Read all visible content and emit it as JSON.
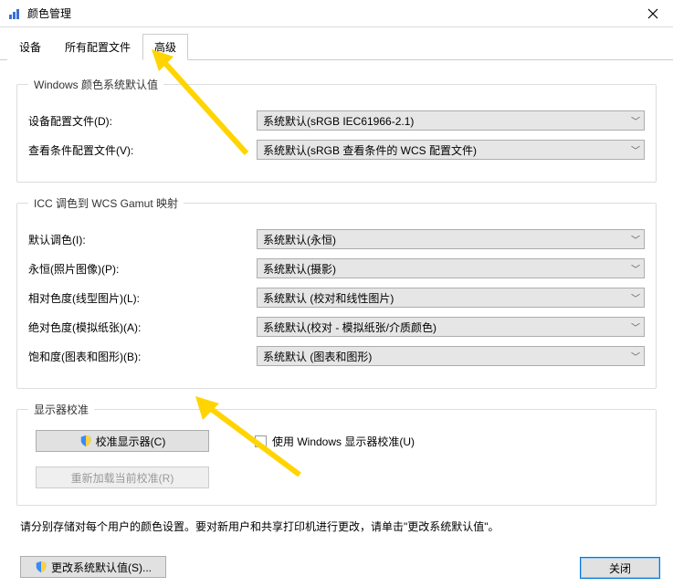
{
  "window": {
    "title": "颜色管理"
  },
  "tabs": {
    "device": "设备",
    "all_profiles": "所有配置文件",
    "advanced": "高级"
  },
  "group_defaults": {
    "legend": "Windows 颜色系统默认值",
    "device_profile_label": "设备配置文件(D):",
    "device_profile_value": "系统默认(sRGB IEC61966-2.1)",
    "viewing_label": "查看条件配置文件(V):",
    "viewing_value": "系统默认(sRGB 查看条件的 WCS 配置文件)"
  },
  "group_gamut": {
    "legend": "ICC 调色到 WCS Gamut 映射",
    "rendering_label": "默认调色(I):",
    "rendering_value": "系统默认(永恒)",
    "perceptual_label": "永恒(照片图像)(P):",
    "perceptual_value": "系统默认(摄影)",
    "relcol_label": "相对色度(线型图片)(L):",
    "relcol_value": "系统默认 (校对和线性图片)",
    "abscol_label": "绝对色度(模拟纸张)(A):",
    "abscol_value": "系统默认(校对 - 模拟纸张/介质颜色)",
    "sat_label": "饱和度(图表和图形)(B):",
    "sat_value": "系统默认 (图表和图形)"
  },
  "group_calib": {
    "legend": "显示器校准",
    "calibrate_btn": "校准显示器(C)",
    "use_win_calib": "使用 Windows 显示器校准(U)",
    "reload_btn": "重新加载当前校准(R)"
  },
  "hint_text": "请分别存储对每个用户的颜色设置。要对新用户和共享打印机进行更改，请单击\"更改系统默认值\"。",
  "sysdef_btn": "更改系统默认值(S)...",
  "close_btn": "关闭"
}
